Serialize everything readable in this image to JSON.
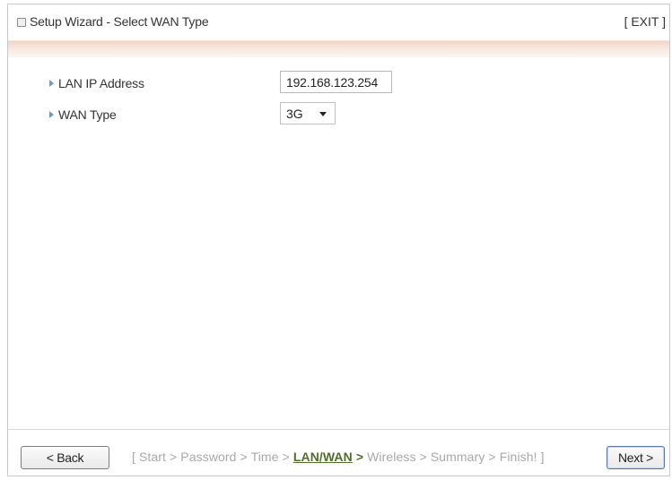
{
  "header": {
    "title": "Setup Wizard - Select WAN Type",
    "exit_label": "[ EXIT ]",
    "icon": "window-icon"
  },
  "form": {
    "lan_ip": {
      "label": "LAN IP Address",
      "value": "192.168.123.254"
    },
    "wan_type": {
      "label": "WAN Type",
      "selected": "3G"
    }
  },
  "footer": {
    "back_label": "< Back",
    "next_label": "Next >",
    "steps": {
      "open": "[ Start > Password > Time > ",
      "current": "LAN/WAN",
      "current_sep": " >",
      "close": " Wireless > Summary > Finish! ]"
    }
  },
  "colors": {
    "band": "#f3d5c8",
    "bullet": "#5f9ed8",
    "current_step": "#4f6f2a",
    "inactive_step": "#a8a8a8"
  }
}
